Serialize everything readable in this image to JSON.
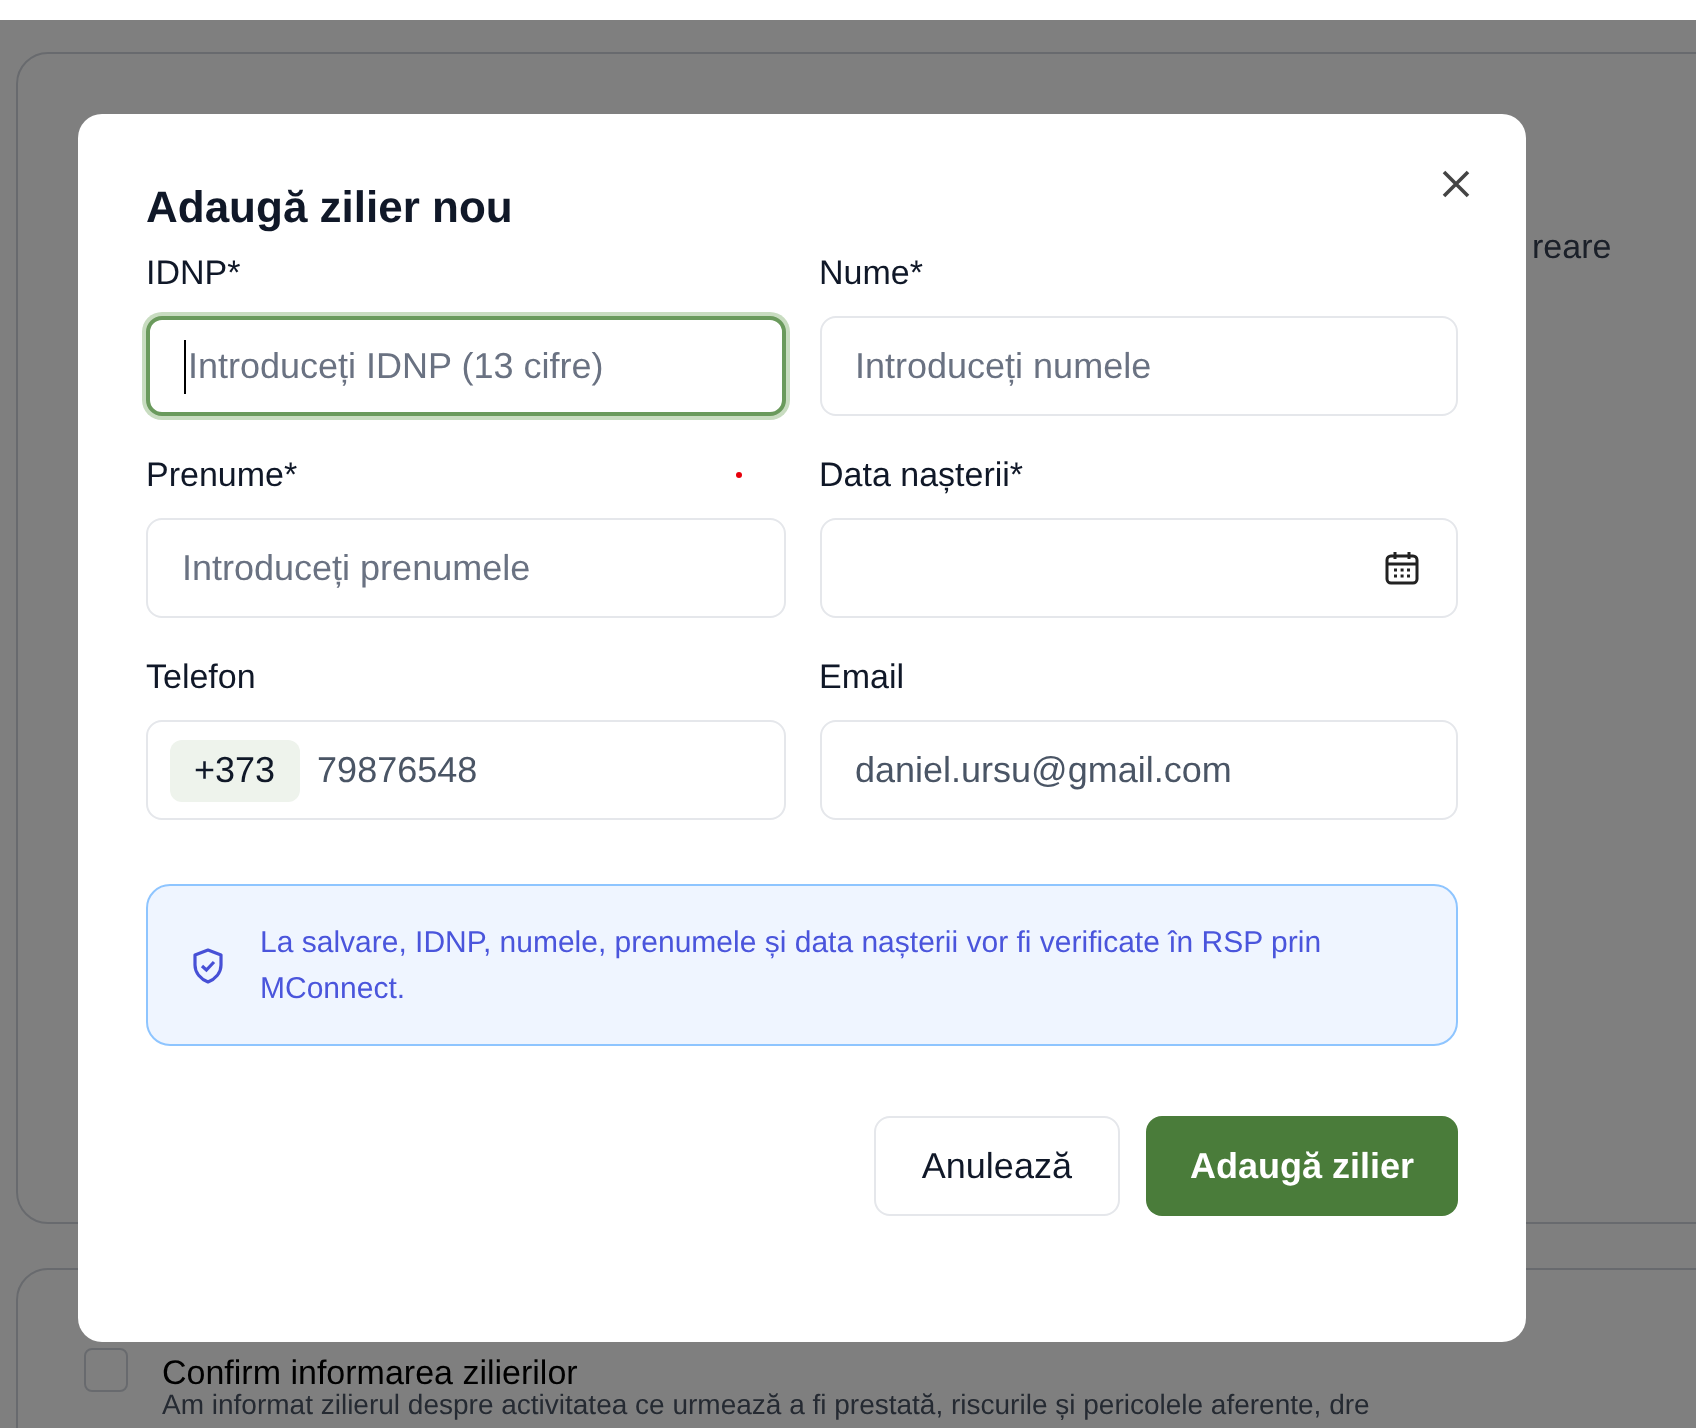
{
  "background": {
    "side_text": "reare",
    "consent": {
      "label": "Confirm informarea zilierilor",
      "checked": false,
      "description": "Am informat zilierul despre activitatea ce urmează a fi prestată, riscurile și pericolele aferente, dre"
    }
  },
  "dialog": {
    "title": "Adaugă zilier nou",
    "fields": [
      {
        "kind": "text",
        "label": "IDNP*",
        "placeholder": "Introduceți IDNP (13 cifre)",
        "focused": true
      },
      {
        "kind": "text",
        "label": "Nume*",
        "placeholder": "Introduceți numele",
        "focused": false
      },
      {
        "kind": "text",
        "label": "Prenume*",
        "placeholder": "Introduceți prenumele",
        "focused": false
      },
      {
        "kind": "date",
        "label": "Data nașterii*",
        "focused": false
      },
      {
        "kind": "phone",
        "label": "Telefon",
        "prefix": "+373",
        "value": "79876548",
        "focused": false
      },
      {
        "kind": "text",
        "label": "Email",
        "value": "daniel.ursu@gmail.com",
        "focused": false
      }
    ],
    "info": "La salvare, IDNP, numele, prenumele și data nașterii vor fi verificate în RSP prin MConnect.",
    "buttons": [
      {
        "kind": "secondary",
        "label": "Anulează"
      },
      {
        "kind": "primary",
        "label": "Adaugă zilier"
      }
    ]
  }
}
